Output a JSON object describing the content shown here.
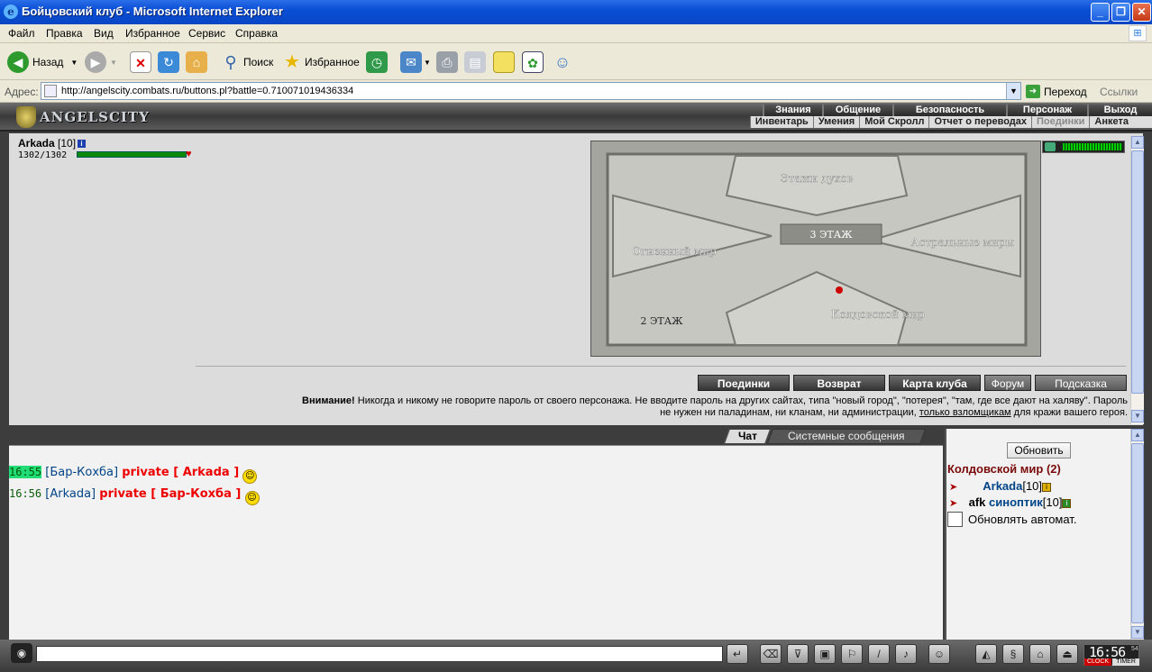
{
  "window": {
    "title": "Бойцовский клуб - Microsoft Internet Explorer"
  },
  "menu": [
    "Файл",
    "Правка",
    "Вид",
    "Избранное",
    "Сервис",
    "Справка"
  ],
  "toolbar": {
    "back": "Назад",
    "search": "Поиск",
    "favorites": "Избранное"
  },
  "address": {
    "label": "Адрес:",
    "url": "http://angelscity.combats.ru/buttons.pl?battle=0.710071019436334",
    "go": "Переход",
    "links": "Ссылки"
  },
  "game": {
    "logo": "ANGELSCITY",
    "nav_top": [
      "Знания",
      "Общение",
      "Безопасность",
      "Персонаж",
      "Выход"
    ],
    "nav_bottom": [
      "Инвентарь",
      "Умения",
      "Мой Скролл",
      "Отчет о переводах",
      "Поединки",
      "Анкета"
    ],
    "character": {
      "name": "Arkada",
      "level": "[10]",
      "hp": "1302/1302",
      "hp_fraction": 1.0
    },
    "map": {
      "labels": [
        "Этажи духов",
        "3 ЭТАЖ",
        "Огненный мир",
        "Астральные миры",
        "Колдовской мир",
        "2 ЭТАЖ"
      ]
    },
    "buttons": [
      "Поединки",
      "Возврат",
      "Карта клуба",
      "Форум",
      "Подсказка"
    ],
    "warning": {
      "bold": "Внимание!",
      "text1": " Никогда и никому не говорите пароль от своего персонажа. Не вводите пароль на других сайтах, типа \"новый город\", \"потерея\", \"там, где все дают на халяву\". Пароль",
      "text2a": "не нужен ни паладинам, ни кланам, ни администрации, ",
      "link": "только взломщикам",
      "text2b": " для кражи вашего героя."
    },
    "tabs": {
      "chat": "Чат",
      "system": "Системные сообщения"
    },
    "messages": [
      {
        "time": "16:55",
        "from": "[Бар-Кохба]",
        "private": "private [ Arkada ]"
      },
      {
        "time": "16:56",
        "from": "[Arkada]",
        "private": "private [ Бар-Кохба ]"
      }
    ],
    "side": {
      "refresh": "Обновить",
      "room": "Колдовской мир (2)",
      "users": [
        {
          "prefix": "",
          "name": "Arkada",
          "level": "[10]"
        },
        {
          "prefix": "afk",
          "name": "синоптик",
          "level": "[10]"
        }
      ],
      "auto_refresh": "Обновлять автомат."
    },
    "clock": {
      "time": "16:56",
      "seconds": "54",
      "label1": "CLOCK",
      "label2": "TIMER"
    }
  }
}
